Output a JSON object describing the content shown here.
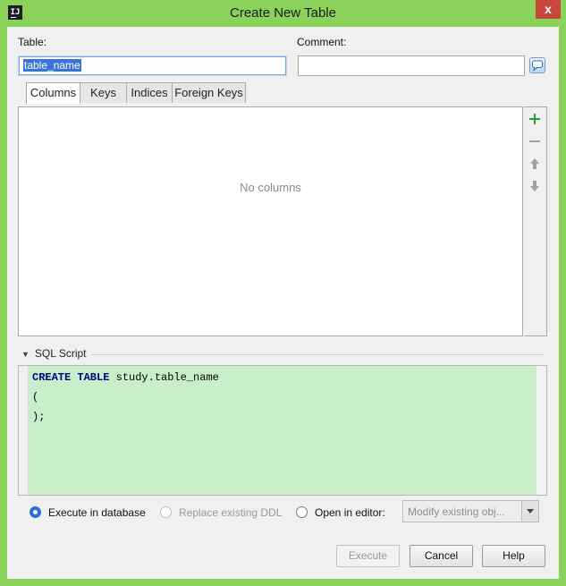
{
  "window": {
    "title": "Create New Table",
    "app_icon": "intellij-icon",
    "close_glyph": "x"
  },
  "form": {
    "table_label": "Table:",
    "table_value": "table_name",
    "comment_label": "Comment:",
    "comment_value": "",
    "comment_button_icon": "speech-bubble-icon"
  },
  "tabs": [
    {
      "label": "Columns",
      "active": true
    },
    {
      "label": "Keys",
      "active": false
    },
    {
      "label": "Indices",
      "active": false
    },
    {
      "label": "Foreign Keys",
      "active": false
    }
  ],
  "columns_panel": {
    "empty_message": "No columns",
    "tools": [
      "add-icon",
      "remove-icon",
      "move-up-icon",
      "move-down-icon"
    ]
  },
  "sql": {
    "header": "SQL Script",
    "lines": [
      {
        "kw": "CREATE TABLE",
        "rest": " study.table_name"
      },
      {
        "kw": "",
        "rest": "("
      },
      {
        "kw": "",
        "rest": ");"
      }
    ]
  },
  "options": {
    "execute_in_db": "Execute in database",
    "replace_ddl": "Replace existing DDL",
    "open_in_editor": "Open in editor:",
    "editor_mode_value": "Modify existing obj...",
    "selected": "execute_in_db"
  },
  "buttons": {
    "execute": "Execute",
    "cancel": "Cancel",
    "help": "Help"
  },
  "colors": {
    "titlebar": "#8ad25a",
    "sql_background": "#c8eeca",
    "keyword": "#000080",
    "accent": "#2b6fcf"
  }
}
